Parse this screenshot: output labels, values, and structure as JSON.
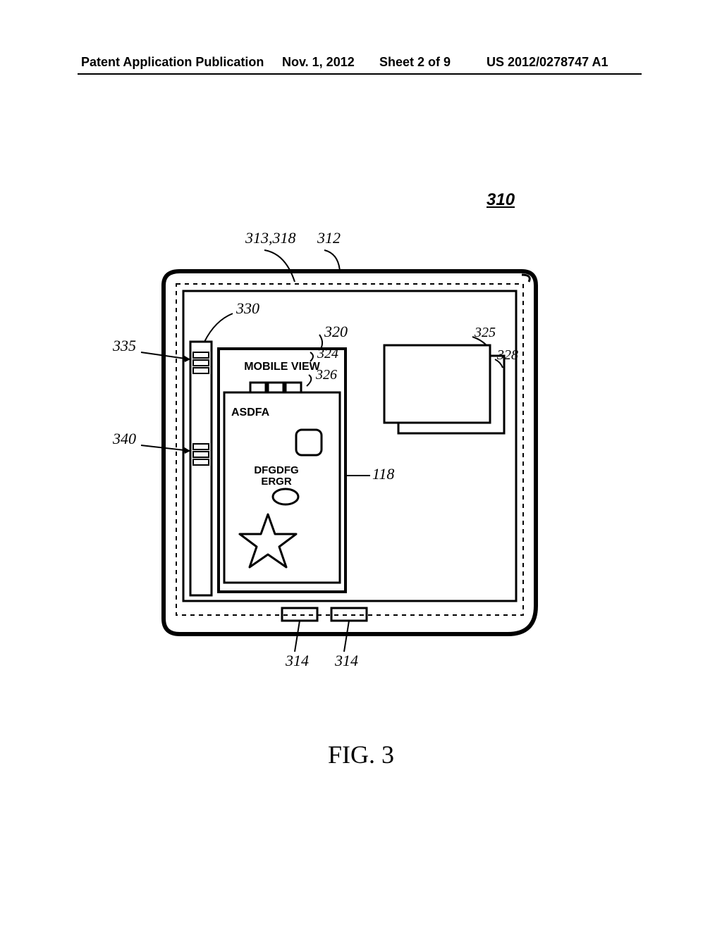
{
  "header": {
    "publication": "Patent Application Publication",
    "date": "Nov. 1, 2012",
    "sheet": "Sheet 2 of 9",
    "docnum": "US 2012/0278747 A1"
  },
  "figure": {
    "caption": "FIG. 3"
  },
  "refs": {
    "r310": "310",
    "r313_318": "313,318",
    "r312": "312",
    "r330": "330",
    "r335": "335",
    "r340": "340",
    "r320": "320",
    "r324": "324",
    "r326": "326",
    "r325": "325",
    "r328": "328",
    "r118": "118",
    "r314a": "314",
    "r314b": "314"
  },
  "mobileView": {
    "title": "MOBILE VIEW",
    "text1": "ASDFA",
    "text2a": "DFGDFG",
    "text2b": "ERGR"
  }
}
